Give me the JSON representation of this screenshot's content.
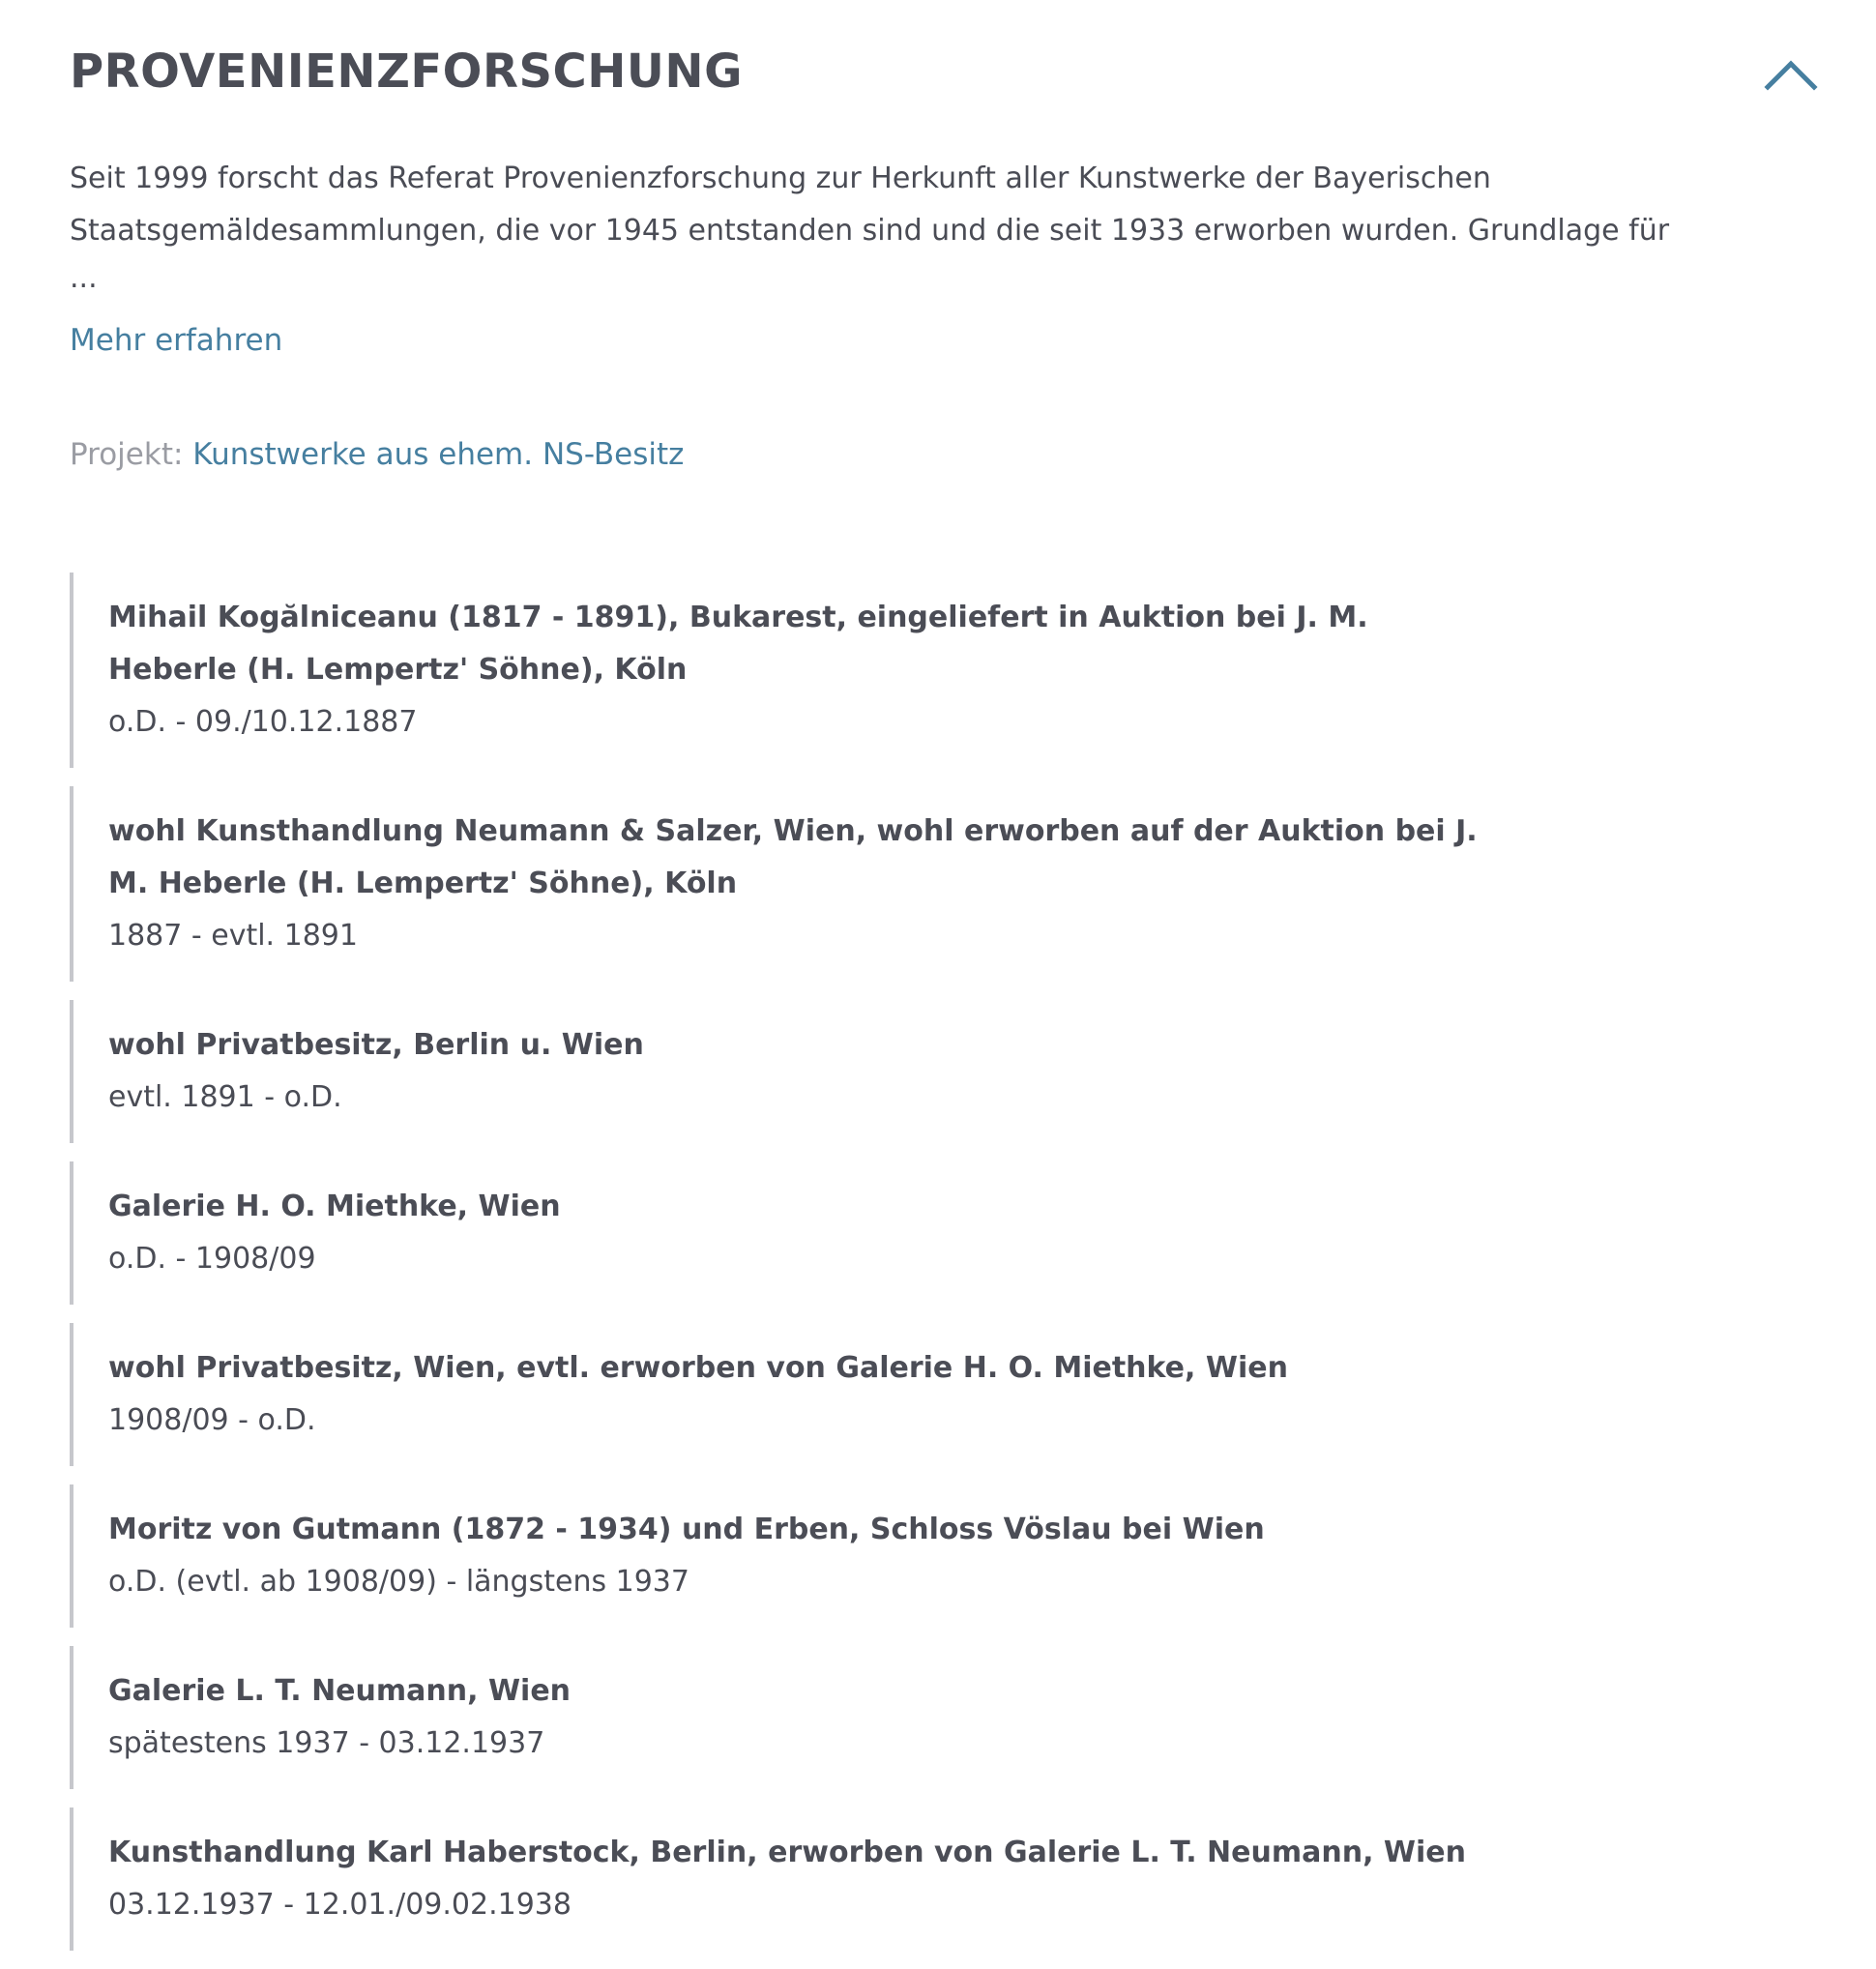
{
  "section": {
    "title": "PROVENIENZFORSCHUNG",
    "intro": "Seit 1999 forscht das Referat Provenienzforschung zur Herkunft aller Kunstwerke der Bayerischen Staatsgemäldesammlungen, die vor 1945 entstanden sind und die seit 1933 erworben wurden. Grundlage für",
    "ellipsis": "...",
    "more_link": "Mehr erfahren",
    "project_label": "Projekt:",
    "project_link": "Kunstwerke aus ehem. NS-Besitz",
    "accent_color": "#467fa0"
  },
  "entries": [
    {
      "name": "Mihail Kogălniceanu (1817 - 1891), Bukarest, eingeliefert in Auktion bei J. M. Heberle (H. Lempertz' Söhne), Köln",
      "date": "o.D. - 09./10.12.1887"
    },
    {
      "name": "wohl Kunsthandlung Neumann & Salzer, Wien, wohl erworben auf der Auktion bei J. M. Heberle (H. Lempertz' Söhne), Köln",
      "date": "1887 - evtl. 1891"
    },
    {
      "name": "wohl Privatbesitz, Berlin u. Wien",
      "date": "evtl. 1891 - o.D."
    },
    {
      "name": "Galerie H. O. Miethke, Wien",
      "date": "o.D. - 1908/09"
    },
    {
      "name": "wohl Privatbesitz, Wien, evtl. erworben von Galerie H. O. Miethke, Wien",
      "date": "1908/09 - o.D."
    },
    {
      "name": "Moritz von Gutmann (1872 - 1934) und Erben, Schloss Vöslau bei Wien",
      "date": "o.D. (evtl. ab 1908/09) - längstens 1937"
    },
    {
      "name": "Galerie L. T. Neumann, Wien",
      "date": "spätestens 1937 - 03.12.1937"
    },
    {
      "name": "Kunsthandlung Karl Haberstock, Berlin, erworben von Galerie L. T. Neumann, Wien",
      "date": "03.12.1937 - 12.01./09.02.1938"
    }
  ]
}
